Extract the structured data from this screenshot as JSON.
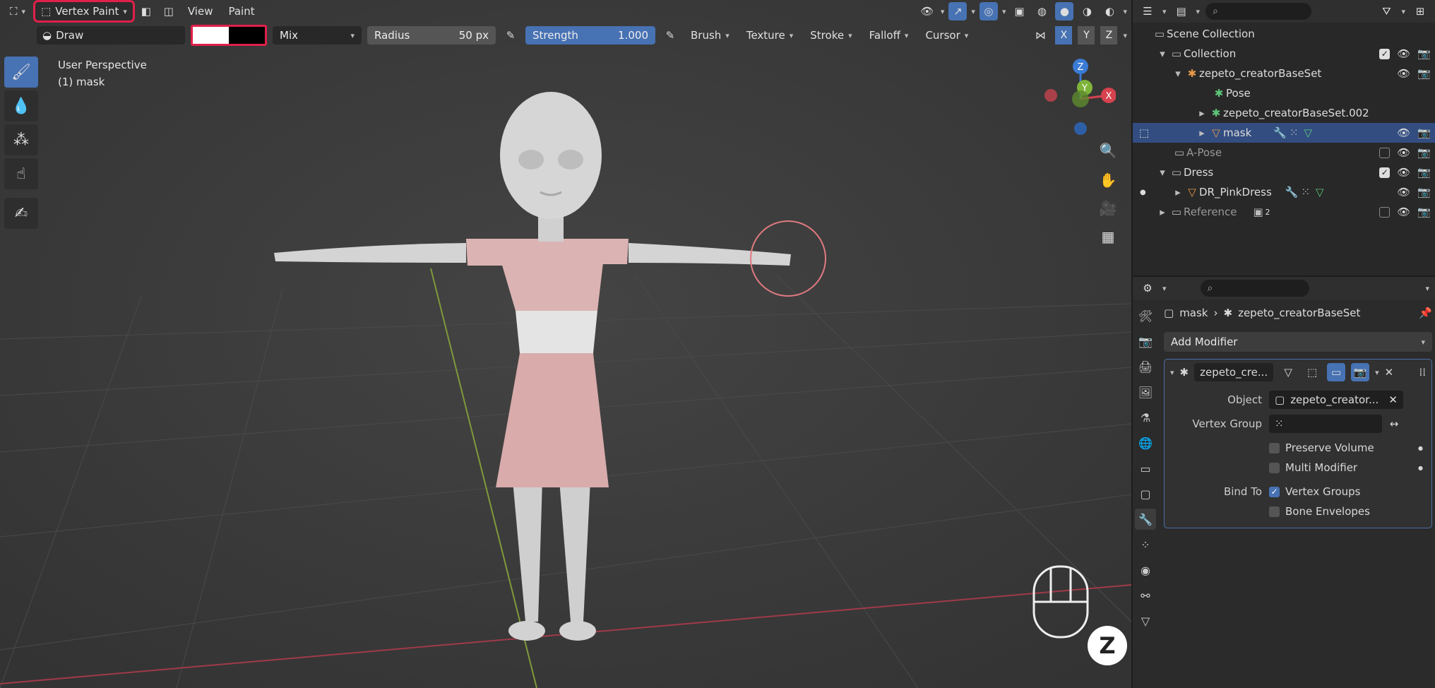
{
  "header": {
    "mode": "Vertex Paint",
    "menus": [
      "View",
      "Paint"
    ]
  },
  "tool_settings": {
    "brush": "Draw",
    "blend": "Mix",
    "radius_label": "Radius",
    "radius_value": "50 px",
    "strength_label": "Strength",
    "strength_value": "1.000",
    "dropdowns": [
      "Brush",
      "Texture",
      "Stroke",
      "Falloff",
      "Cursor"
    ],
    "axes": [
      "X",
      "Y",
      "Z"
    ]
  },
  "viewport": {
    "view_name": "User Perspective",
    "object_name": "(1) mask",
    "gizmo": {
      "x": "X",
      "y": "Y",
      "z": "Z"
    }
  },
  "outliner": {
    "search_placeholder": "",
    "rows": [
      {
        "label": "Scene Collection"
      },
      {
        "label": "Collection"
      },
      {
        "label": "zepeto_creatorBaseSet"
      },
      {
        "label": "Pose"
      },
      {
        "label": "zepeto_creatorBaseSet.002"
      },
      {
        "label": "mask"
      },
      {
        "label": "A-Pose"
      },
      {
        "label": "Dress"
      },
      {
        "label": "DR_PinkDress"
      },
      {
        "label": "Reference"
      }
    ],
    "reference_count": "2"
  },
  "properties": {
    "breadcrumb_object": "mask",
    "breadcrumb_modifier": "zepeto_creatorBaseSet",
    "add_modifier": "Add Modifier",
    "modifier_name": "zepeto_cre...",
    "object_label": "Object",
    "object_value": "zepeto_creator...",
    "vertex_group_label": "Vertex Group",
    "preserve_volume": "Preserve Volume",
    "multi_modifier": "Multi Modifier",
    "bind_to_label": "Bind To",
    "vertex_groups": "Vertex Groups",
    "bone_envelopes": "Bone Envelopes"
  },
  "colors": {
    "accent": "#4772b3",
    "highlight": "#e0204a",
    "dress": "#dcb0b0",
    "skin": "#cfcfcf"
  }
}
